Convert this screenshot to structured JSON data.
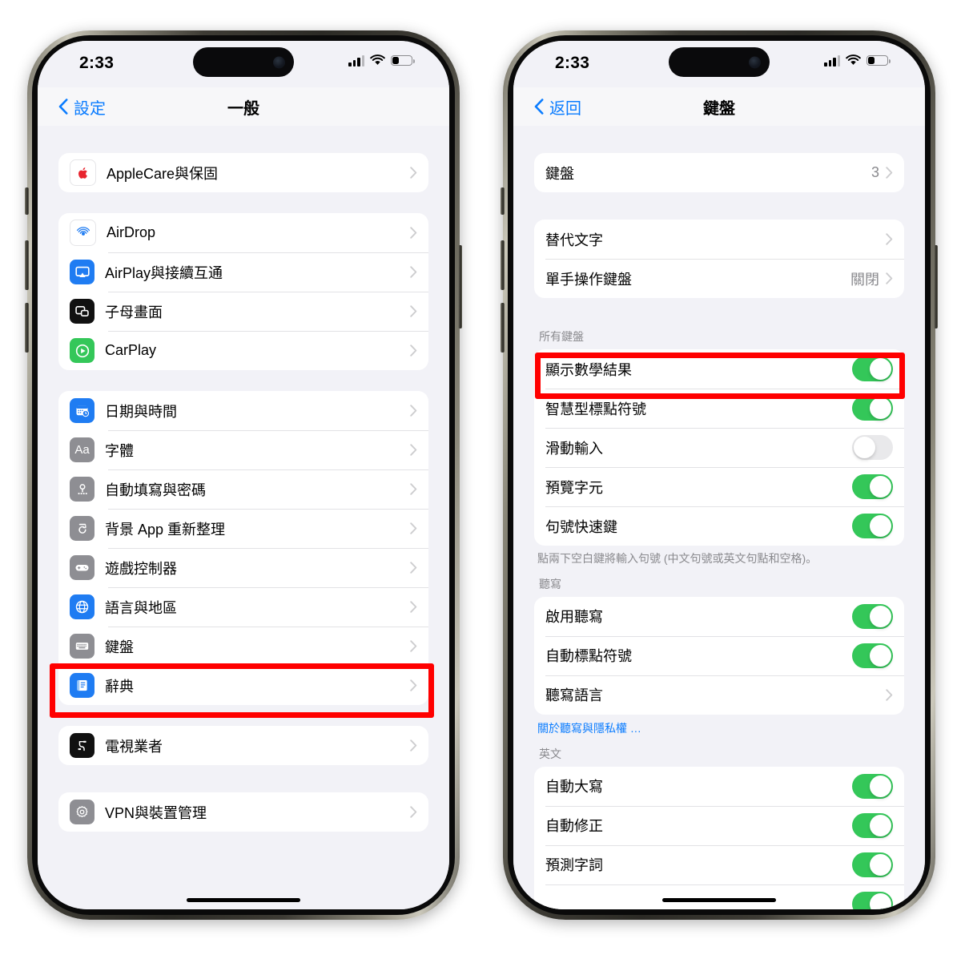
{
  "colors": {
    "accent_blue": "#0a7cff",
    "toggle_on_green": "#34c759",
    "highlight_red": "#ff0000",
    "page_bg": "#f2f2f7",
    "secondary_text": "#8a8a8e"
  },
  "left_phone": {
    "status_bar": {
      "time": "2:33",
      "signal_icon": "cellular-bars-icon",
      "wifi_icon": "wifi-icon",
      "battery_icon": "battery-icon",
      "battery_percent": 30
    },
    "nav": {
      "back_label": "設定",
      "title": "一般"
    },
    "groups": [
      {
        "items": [
          {
            "label": "AppleCare與保固",
            "icon": "applecare-icon",
            "icon_bg": "#ffffff",
            "accessory": "chevron"
          }
        ]
      },
      {
        "items": [
          {
            "label": "AirDrop",
            "icon": "airdrop-icon",
            "icon_bg": "#ffffff",
            "accessory": "chevron"
          },
          {
            "label": "AirPlay與接續互通",
            "icon": "airplay-icon",
            "icon_bg": "#1f7cf2",
            "accessory": "chevron"
          },
          {
            "label": "子母畫面",
            "icon": "picture-in-picture-icon",
            "icon_bg": "#111111",
            "accessory": "chevron"
          },
          {
            "label": "CarPlay",
            "icon": "carplay-icon",
            "icon_bg": "#34c759",
            "accessory": "chevron"
          }
        ]
      },
      {
        "items": [
          {
            "label": "日期與時間",
            "icon": "calendar-clock-icon",
            "icon_bg": "#1f7cf2",
            "accessory": "chevron"
          },
          {
            "label": "字體",
            "icon": "font-icon",
            "icon_bg": "#8e8e93",
            "accessory": "chevron"
          },
          {
            "label": "自動填寫與密碼",
            "icon": "key-icon",
            "icon_bg": "#8e8e93",
            "accessory": "chevron"
          },
          {
            "label": "背景 App 重新整理",
            "icon": "refresh-icon",
            "icon_bg": "#8e8e93",
            "accessory": "chevron"
          },
          {
            "label": "遊戲控制器",
            "icon": "gamepad-icon",
            "icon_bg": "#8e8e93",
            "accessory": "chevron"
          },
          {
            "label": "語言與地區",
            "icon": "globe-icon",
            "icon_bg": "#1f7cf2",
            "accessory": "chevron"
          },
          {
            "label": "鍵盤",
            "icon": "keyboard-icon",
            "icon_bg": "#8e8e93",
            "accessory": "chevron",
            "highlighted": true
          },
          {
            "label": "辭典",
            "icon": "dictionary-icon",
            "icon_bg": "#1f7cf2",
            "accessory": "chevron"
          }
        ]
      },
      {
        "items": [
          {
            "label": "電視業者",
            "icon": "tv-provider-icon",
            "icon_bg": "#111111",
            "accessory": "chevron"
          }
        ]
      },
      {
        "items": [
          {
            "label": "VPN與裝置管理",
            "icon": "gear-icon",
            "icon_bg": "#8e8e93",
            "accessory": "chevron"
          }
        ]
      }
    ]
  },
  "right_phone": {
    "status_bar": {
      "time": "2:33",
      "signal_icon": "cellular-bars-icon",
      "wifi_icon": "wifi-icon",
      "battery_icon": "battery-icon",
      "battery_percent": 30
    },
    "nav": {
      "back_label": "返回",
      "title": "鍵盤"
    },
    "sections": [
      {
        "header": "",
        "rows": [
          {
            "label": "鍵盤",
            "value": "3",
            "type": "link"
          }
        ],
        "footnote": ""
      },
      {
        "header": "",
        "rows": [
          {
            "label": "替代文字",
            "value": "",
            "type": "link"
          },
          {
            "label": "單手操作鍵盤",
            "value": "關閉",
            "type": "link"
          }
        ],
        "footnote": ""
      },
      {
        "header": "所有鍵盤",
        "rows": [
          {
            "label": "顯示數學結果",
            "type": "toggle",
            "on": true,
            "highlighted": true
          },
          {
            "label": "智慧型標點符號",
            "type": "toggle",
            "on": true
          },
          {
            "label": "滑動輸入",
            "type": "toggle",
            "on": false
          },
          {
            "label": "預覽字元",
            "type": "toggle",
            "on": true
          },
          {
            "label": "句號快速鍵",
            "type": "toggle",
            "on": true
          }
        ],
        "footnote": "點兩下空白鍵將輸入句號 (中文句號或英文句點和空格)。"
      },
      {
        "header": "聽寫",
        "rows": [
          {
            "label": "啟用聽寫",
            "type": "toggle",
            "on": true
          },
          {
            "label": "自動標點符號",
            "type": "toggle",
            "on": true
          },
          {
            "label": "聽寫語言",
            "value": "",
            "type": "link"
          }
        ],
        "footlink": "關於聽寫與隱私權 …"
      },
      {
        "header": "英文",
        "rows": [
          {
            "label": "自動大寫",
            "type": "toggle",
            "on": true
          },
          {
            "label": "自動修正",
            "type": "toggle",
            "on": true
          },
          {
            "label": "預測字詞",
            "type": "toggle",
            "on": true
          }
        ],
        "footnote": ""
      }
    ]
  }
}
